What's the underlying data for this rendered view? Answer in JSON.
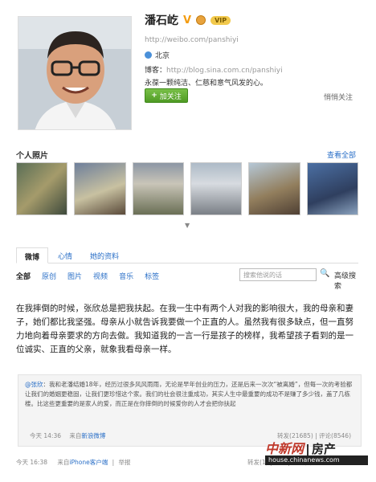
{
  "profile": {
    "name": "潘石屹",
    "v_badge": "V",
    "vip_label": "VIP",
    "url": "http://weibo.com/panshiyi",
    "location": "北京",
    "blog_label": "博客：",
    "blog_url": "http://blog.sina.com.cn/panshiyi",
    "intro": "永葆一颗纯洁、仁慈和意气风发的心。",
    "follow_label": "加关注",
    "follow_plus": "+",
    "reject_label": "悄悄关注"
  },
  "photos": {
    "title": "个人照片",
    "view_all": "查看全部",
    "arrow": "▼"
  },
  "tabs": [
    "微博",
    "心情",
    "她的资料"
  ],
  "filters": [
    "全部",
    "原创",
    "图片",
    "视频",
    "音乐",
    "标签"
  ],
  "search": {
    "placeholder": "搜索他说的话",
    "icon": "🔍",
    "advanced": "高级搜索"
  },
  "post": {
    "text": "在我摔倒的时候，张欣总是把我扶起。在我一生中有两个人对我的影响很大，我的母亲和妻子，她们都比我坚强。母亲从小就告诉我要做一个正直的人。虽然我有很多缺点，但一直努力地向着母亲要求的方向去做。我知道我的一言一行是孩子的榜样，我希望孩子看到的是一位诚实、正直的父亲，就象我看母亲一样。",
    "time": "今天 16:38",
    "source_prefix": "来自",
    "source": "iPhone客户端",
    "report": "举报",
    "stats": "转发(1) | 收藏 | 评论(5)"
  },
  "retweet": {
    "author": "@张欣",
    "text": "：我和老潘结婚18年，经历过很多风风雨雨，无论是早年创业的压力，还是后来一次次“被离婚”，但每一次的考验都让我们的婚姻更稳固，让我们更珍惜这个家。我们的社会很注重成功，其实人生中最重要的成功不是赚了多少钱，盖了几栋楼。比这些更重要的是家人的爱，而正是在你摔倒的时候爱你的人才会把你扶起",
    "time": "今天 14:36",
    "source_prefix": "来自",
    "source": "新浪微博",
    "stats": "转发(21685) | 评论(8546)"
  },
  "watermark": {
    "brand": "中新网",
    "section": "房产",
    "url": "house.chinanews.com"
  }
}
